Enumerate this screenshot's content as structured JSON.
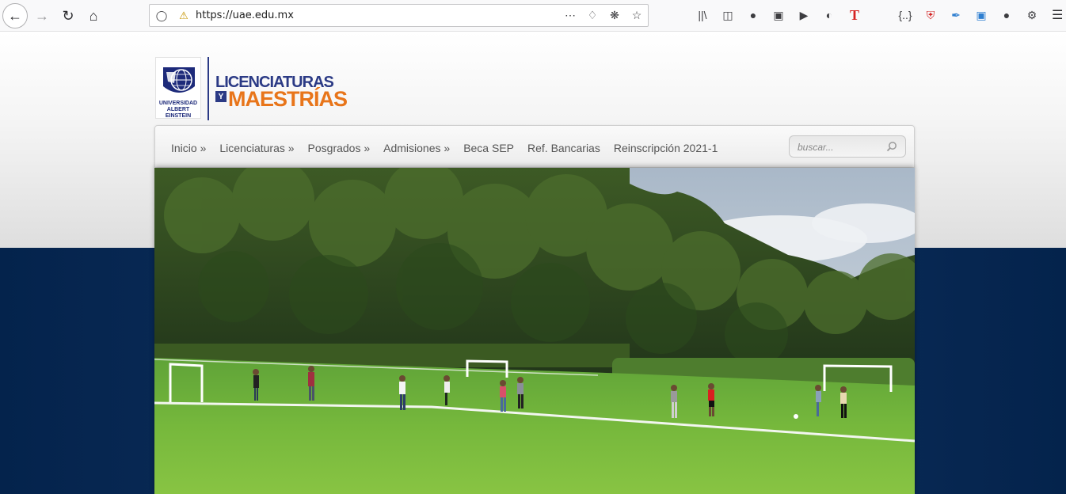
{
  "browser": {
    "url": "https://uae.edu.mx",
    "icons": {
      "back": "back-arrow-icon",
      "forward": "forward-arrow-icon",
      "reload": "reload-icon",
      "home": "home-icon",
      "tracking": "tracking-shield-icon",
      "lock": "insecure-lock-icon",
      "more": "more-dots-icon",
      "pocket": "pocket-icon",
      "extension": "extension-icon",
      "bookmark": "bookmark-star-icon"
    }
  },
  "site": {
    "logo": {
      "university_line1": "UNIVERSIDAD",
      "university_line2": "ALBERT EINSTEIN",
      "brand_line1": "LICENCIATURAS",
      "brand_y": "Y",
      "brand_line2": "MAESTRÍAS"
    },
    "nav": [
      {
        "label": "Inicio »"
      },
      {
        "label": "Licenciaturas »"
      },
      {
        "label": "Posgrados »"
      },
      {
        "label": "Admisiones »"
      },
      {
        "label": "Beca SEP"
      },
      {
        "label": "Ref. Bancarias"
      },
      {
        "label": "Reinscripción 2021-1"
      }
    ],
    "search": {
      "placeholder": "buscar..."
    },
    "colors": {
      "brand_blue": "#2b3a85",
      "brand_orange": "#e8751a",
      "footer_navy": "#04234c"
    }
  }
}
